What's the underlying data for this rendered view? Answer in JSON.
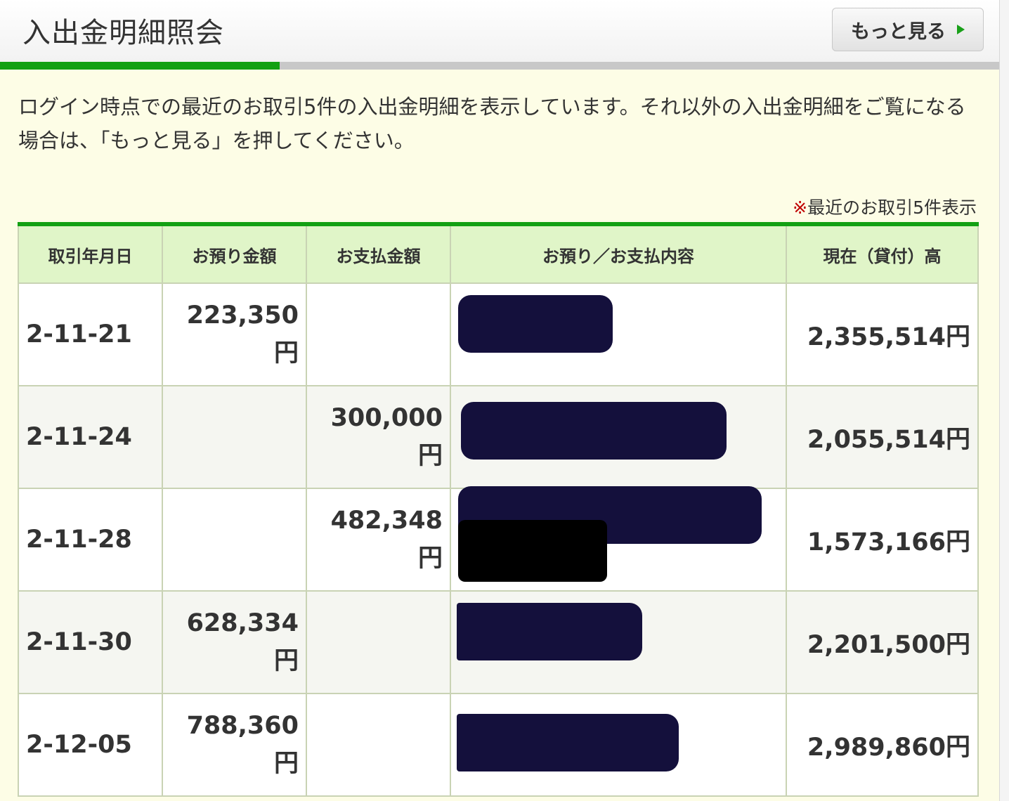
{
  "header": {
    "title": "入出金明細照会",
    "more_button": "もっと見る"
  },
  "progress": {
    "fraction": 0.28
  },
  "description": "ログイン時点での最近のお取引5件の入出金明細を表示しています。それ以外の入出金明細をご覧になる場合は、「もっと見る」を押してください。",
  "note": {
    "mark": "※",
    "text": "最近のお取引5件表示"
  },
  "table": {
    "headers": [
      "取引年月日",
      "お預り金額",
      "お支払金額",
      "お預り／お支払内容",
      "現在（貸付）高"
    ],
    "rows": [
      {
        "date": "2-11-21",
        "deposit": "223,350",
        "deposit_unit": "円",
        "payment": "",
        "payment_unit": "",
        "balance": "2,355,514円"
      },
      {
        "date": "2-11-24",
        "deposit": "",
        "deposit_unit": "",
        "payment": "300,000",
        "payment_unit": "円",
        "balance": "2,055,514円"
      },
      {
        "date": "2-11-28",
        "deposit": "",
        "deposit_unit": "",
        "payment": "482,348",
        "payment_unit": "円",
        "balance": "1,573,166円"
      },
      {
        "date": "2-11-30",
        "deposit": "628,334",
        "deposit_unit": "円",
        "payment": "",
        "payment_unit": "",
        "balance": "2,201,500円"
      },
      {
        "date": "2-12-05",
        "deposit": "788,360",
        "deposit_unit": "円",
        "payment": "",
        "payment_unit": "",
        "balance": "2,989,860円"
      }
    ]
  },
  "colors": {
    "accent_green": "#13a013",
    "header_cell_bg": "#e0f5c8",
    "redaction": "#14103c",
    "page_bg": "#fdfde6"
  }
}
